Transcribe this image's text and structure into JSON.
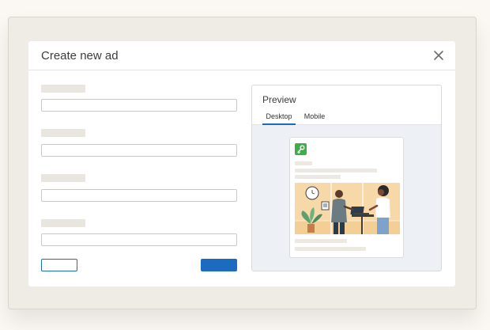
{
  "dialog": {
    "title": "Create new ad",
    "close_icon": "close-icon"
  },
  "form": {
    "fields": [
      {
        "label": "",
        "value": ""
      },
      {
        "label": "",
        "value": ""
      },
      {
        "label": "",
        "value": ""
      },
      {
        "label": "",
        "value": ""
      }
    ],
    "cancel_label": "",
    "submit_label": ""
  },
  "preview": {
    "title": "Preview",
    "tabs": [
      {
        "label": "Desktop",
        "active": true
      },
      {
        "label": "Mobile",
        "active": false
      }
    ],
    "ad_logo_icon": "key-icon",
    "ad_image": "office-illustration"
  },
  "colors": {
    "accent": "#1b6cc1",
    "logo_green": "#3fae49",
    "preview_bg": "#edf1f6",
    "page_bg": "#fbf8f3"
  }
}
